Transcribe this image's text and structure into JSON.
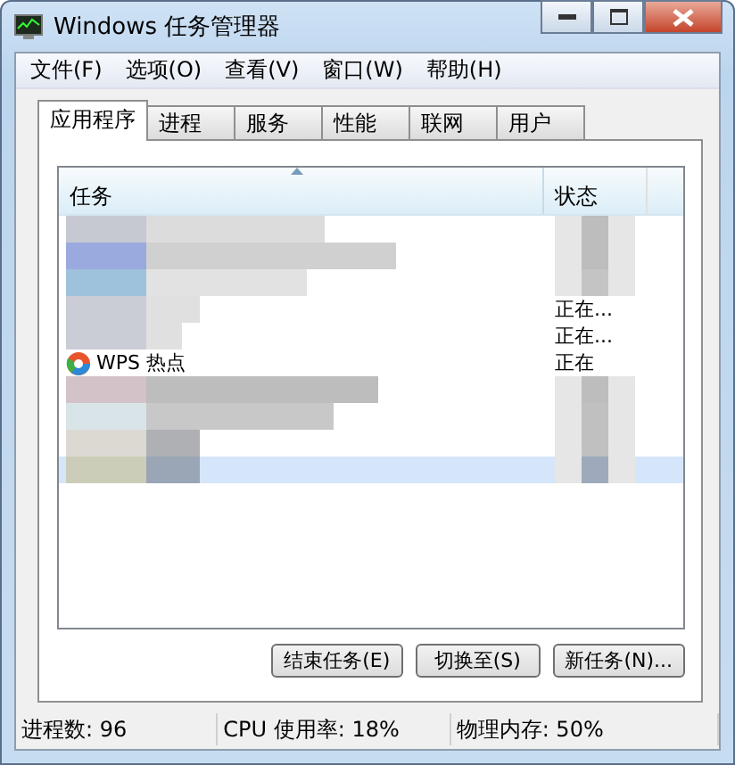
{
  "window": {
    "title": "Windows 任务管理器"
  },
  "menu": [
    "文件(F)",
    "选项(O)",
    "查看(V)",
    "窗口(W)",
    "帮助(H)"
  ],
  "tabs": [
    {
      "label": "应用程序",
      "selected": true
    },
    {
      "label": "进程",
      "selected": false
    },
    {
      "label": "服务",
      "selected": false
    },
    {
      "label": "性能",
      "selected": false
    },
    {
      "label": "联网",
      "selected": false
    },
    {
      "label": "用户",
      "selected": false
    }
  ],
  "table": {
    "columns": [
      "任务",
      "状态"
    ],
    "rows": [
      {
        "selected": false
      },
      {
        "selected": false
      },
      {
        "selected": false
      },
      {
        "status": "正在...",
        "selected": false
      },
      {
        "status": "正在...",
        "selected": false
      },
      {
        "name": "WPS 热点",
        "status": "正在",
        "selected": false
      },
      {
        "selected": false
      },
      {
        "selected": false
      },
      {
        "selected": false
      },
      {
        "selected": true
      }
    ]
  },
  "mosaic": {
    "kind": "picture"
  },
  "buttons": [
    "结束任务(E)",
    "切换至(S)",
    "新任务(N)..."
  ],
  "status_bar": [
    "进程数: 96",
    "CPU 使用率: 18%",
    "物理内存: 50%"
  ]
}
